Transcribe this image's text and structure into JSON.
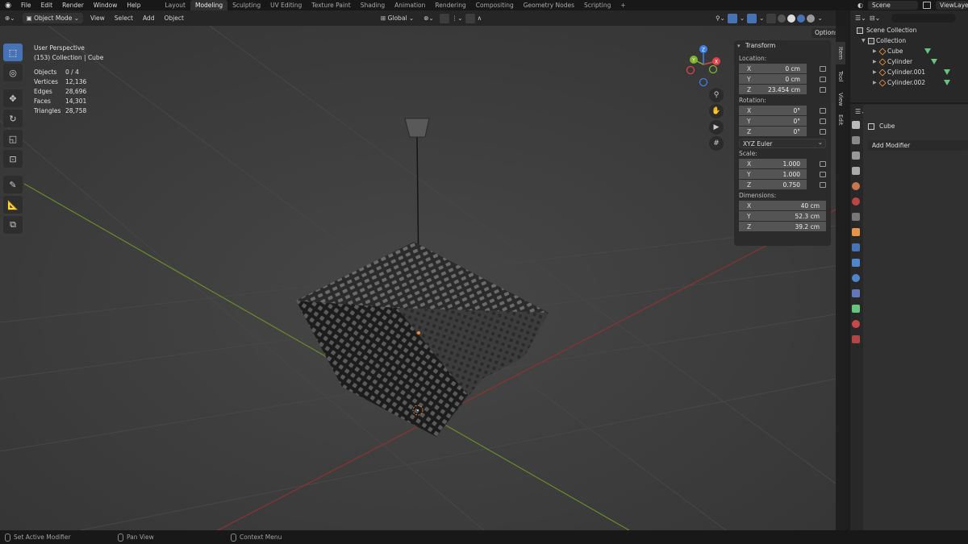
{
  "top_menu": {
    "items": [
      "File",
      "Edit",
      "Render",
      "Window",
      "Help"
    ],
    "workspaces": [
      "Layout",
      "Modeling",
      "Sculpting",
      "UV Editing",
      "Texture Paint",
      "Shading",
      "Animation",
      "Rendering",
      "Compositing",
      "Geometry Nodes",
      "Scripting"
    ],
    "active_workspace": "Modeling",
    "scene_label": "Scene",
    "view_layer_label": "ViewLayer"
  },
  "viewport_header": {
    "mode": "Object Mode",
    "menu": [
      "View",
      "Select",
      "Add",
      "Object"
    ],
    "orientation": "Global",
    "options_label": "Options"
  },
  "viewport": {
    "perspective_label": "User Perspective",
    "collection_label": "(153) Collection | Cube",
    "stats": [
      {
        "key": "Objects",
        "value": "0 / 4"
      },
      {
        "key": "Vertices",
        "value": "12,136"
      },
      {
        "key": "Edges",
        "value": "28,696"
      },
      {
        "key": "Faces",
        "value": "14,301"
      },
      {
        "key": "Triangles",
        "value": "28,758"
      }
    ]
  },
  "transform_panel": {
    "title": "Transform",
    "location_label": "Location:",
    "location": {
      "x": "0 cm",
      "y": "0 cm",
      "z": "23.454 cm"
    },
    "rotation_label": "Rotation:",
    "rotation": {
      "x": "0°",
      "y": "0°",
      "z": "0°"
    },
    "rotation_mode": "XYZ Euler",
    "scale_label": "Scale:",
    "scale": {
      "x": "1.000",
      "y": "1.000",
      "z": "0.750"
    },
    "dimensions_label": "Dimensions:",
    "dimensions": {
      "x": "40 cm",
      "y": "52.3 cm",
      "z": "39.2 cm"
    },
    "axis_labels": {
      "x": "X",
      "y": "Y",
      "z": "Z"
    }
  },
  "side_tabs": [
    "Item",
    "Tool",
    "View",
    "Edit"
  ],
  "outliner": {
    "root": "Scene Collection",
    "collection": "Collection",
    "objects": [
      "Cube",
      "Cylinder",
      "Cylinder.001",
      "Cylinder.002"
    ]
  },
  "properties": {
    "object_name": "Cube",
    "add_modifier_label": "Add Modifier"
  },
  "status_bar": {
    "left": "Set Active Modifier",
    "middle": "Pan View",
    "right": "Context Menu"
  },
  "colors": {
    "accent": "#4772b3",
    "object_orange": "#e5944a",
    "mesh_green": "#67c47e",
    "x_axis": "#e0414d",
    "y_axis": "#7fb32e",
    "z_axis": "#3e7fe8"
  },
  "gizmo_axes": {
    "x": "X",
    "y": "Y",
    "z": "Z"
  }
}
